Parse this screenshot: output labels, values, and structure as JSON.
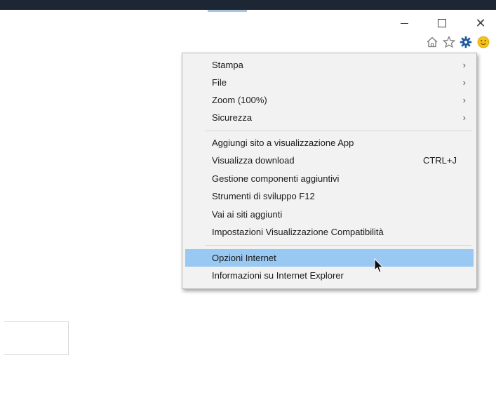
{
  "window_controls": {
    "minimize": "—",
    "close": "✕"
  },
  "toolbar": {
    "icons": [
      "home-icon",
      "favorites-star-icon",
      "tools-gear-icon",
      "feedback-smiley-icon"
    ]
  },
  "menu": {
    "items": [
      {
        "label": "Stampa",
        "submenu": true
      },
      {
        "label": "File",
        "submenu": true
      },
      {
        "label": "Zoom (100%)",
        "submenu": true
      },
      {
        "label": "Sicurezza",
        "submenu": true
      },
      {
        "label": "Aggiungi sito a visualizzazione App"
      },
      {
        "label": "Visualizza download",
        "shortcut": "CTRL+J"
      },
      {
        "label": "Gestione componenti aggiuntivi"
      },
      {
        "label": "Strumenti di sviluppo F12"
      },
      {
        "label": "Vai ai siti aggiunti"
      },
      {
        "label": "Impostazioni Visualizzazione Compatibilità"
      },
      {
        "label": "Opzioni Internet",
        "highlighted": true
      },
      {
        "label": "Informazioni su Internet Explorer"
      }
    ],
    "arrow": "›"
  },
  "colors": {
    "highlight": "#99c9f3",
    "gear": "#1e5aa0",
    "smiley": "#f4c21a"
  }
}
